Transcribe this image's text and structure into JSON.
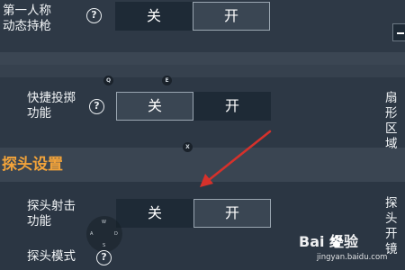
{
  "settings": {
    "first_person_dynamic_gun": {
      "label": "第一人称\n动态持枪",
      "help": "?",
      "off": "关",
      "on": "开",
      "value": "on"
    },
    "quick_throw": {
      "label": "快捷投掷\n功能",
      "help": "?",
      "off": "关",
      "on": "开",
      "value": "off"
    },
    "peek_fire": {
      "label": "探头射击\n功能",
      "help": "?",
      "off": "关",
      "on": "开",
      "value": "on"
    },
    "peek_mode": {
      "label": "探头模式",
      "help": "?"
    }
  },
  "section": {
    "title": "探头设置"
  },
  "right_partial": {
    "fan_label": "扇形\n区域",
    "peek_label": "探头\n开镜"
  },
  "key_hints": {
    "q": "Q",
    "e": "E",
    "x": "X",
    "dpad": {
      "up": "W",
      "left": "A",
      "down": "S",
      "right": "D"
    }
  },
  "annotation": {
    "arrow_color": "#d6312b"
  },
  "watermark": {
    "brand": "Bai 经验",
    "url": "jingyan.baidu.com"
  },
  "colors": {
    "accent": "#f2a33a",
    "background": "#2c3744",
    "toggle_dark": "#1e2a36"
  }
}
